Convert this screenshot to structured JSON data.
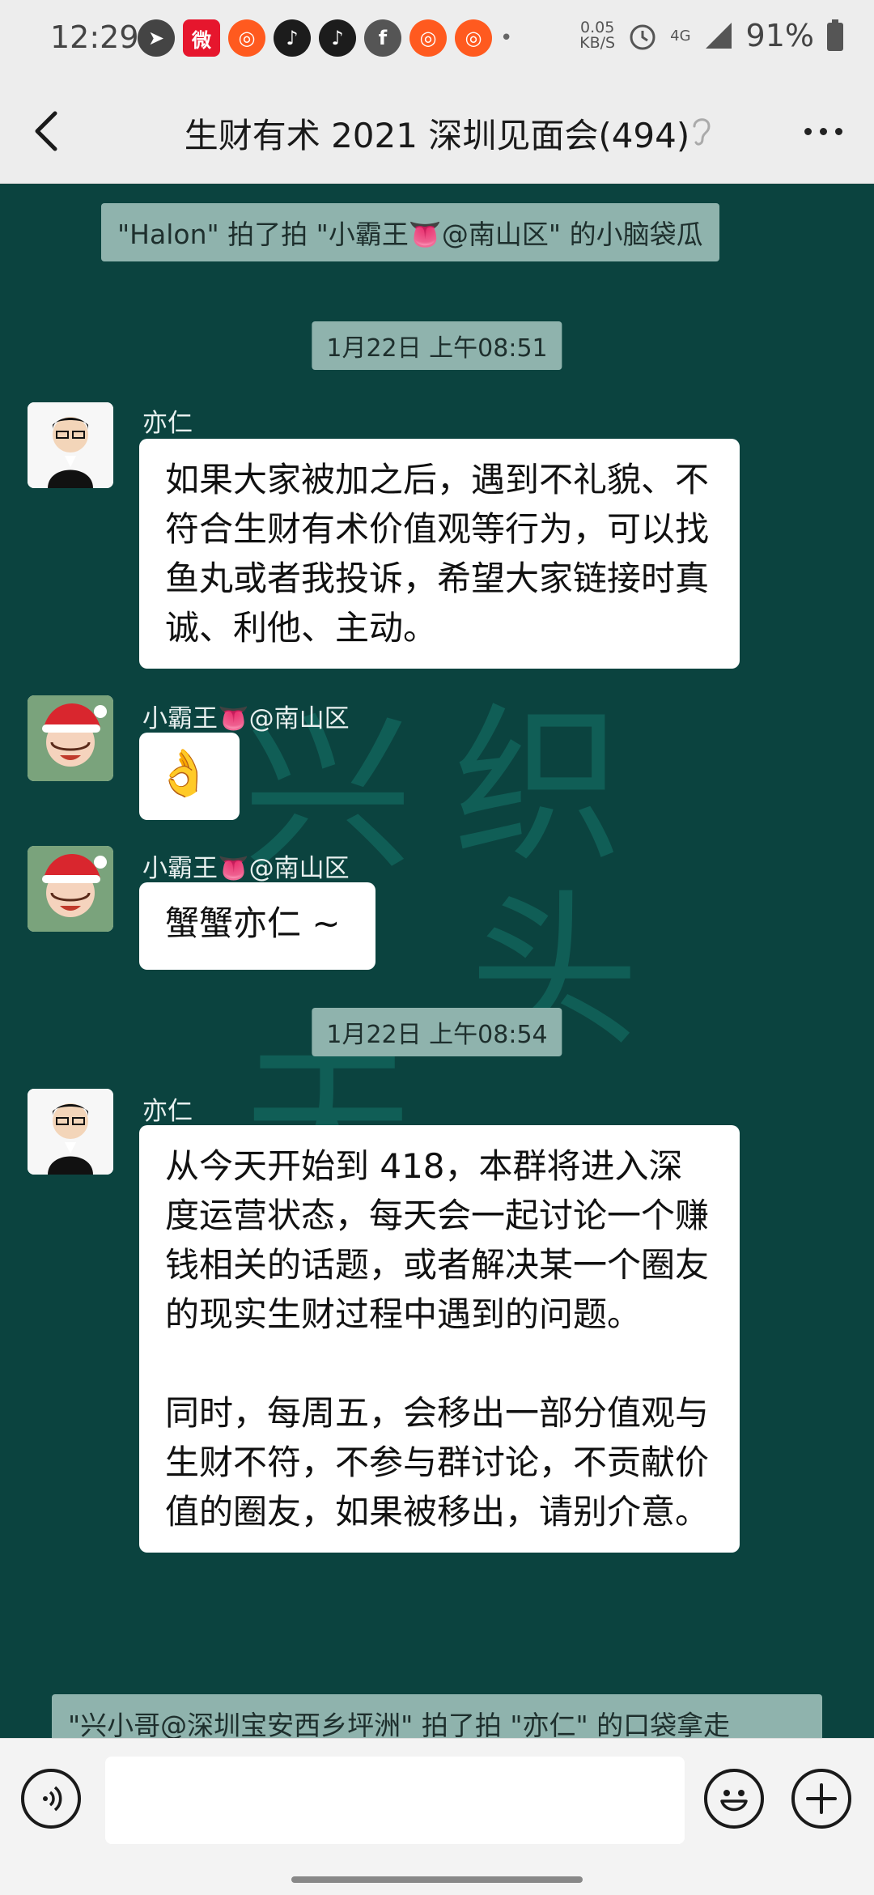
{
  "status_bar": {
    "time": "12:29",
    "net_speed_value": "0.05",
    "net_speed_unit": "KB/S",
    "network": "4G",
    "battery": "91%"
  },
  "header": {
    "back_icon": "chevron-left-icon",
    "title": "生财有术 2021 深圳见面会(494)",
    "mute_icon": "ear-icon",
    "more_icon": "more-dots-icon"
  },
  "messages": [
    {
      "type": "system",
      "text": "\"Halon\" 拍了拍 \"小霸王👅@南山区\" 的小脑袋瓜"
    },
    {
      "type": "time",
      "text": "1月22日 上午08:51"
    },
    {
      "type": "msg",
      "sender": "亦仁",
      "paragraphs": [
        "如果大家被加之后，遇到不礼貌、不符合生财有术价值观等行为，可以找鱼丸或者我投诉，希望大家链接时真诚、利他、主动。"
      ]
    },
    {
      "type": "msg",
      "sender": "小霸王👅@南山区",
      "paragraphs": [
        "👌"
      ]
    },
    {
      "type": "msg",
      "sender": "小霸王👅@南山区",
      "paragraphs": [
        "蟹蟹亦仁 ~"
      ]
    },
    {
      "type": "time",
      "text": "1月22日 上午08:54"
    },
    {
      "type": "msg",
      "sender": "亦仁",
      "paragraphs": [
        "从今天开始到 418，本群将进入深度运营状态，每天会一起讨论一个赚钱相关的话题，或者解决某一个圈友的现实生财过程中遇到的问题。",
        "同时，每周五，会移出一部分值观与生财不符，不参与群讨论，不贡献价值的圈友，如果被移出，请别介意。"
      ]
    },
    {
      "type": "system",
      "text": "\"兴小哥@深圳宝安西乡坪洲\" 拍了拍 \"亦仁\" 的口袋拿走"
    }
  ],
  "input_bar": {
    "voice_icon": "voice-icon",
    "emoji_icon": "emoji-icon",
    "plus_icon": "plus-icon",
    "input_value": ""
  },
  "colors": {
    "chat_background": "#0b433f",
    "notice_background": "#8fb3ad",
    "bubble_background": "#ffffff"
  }
}
